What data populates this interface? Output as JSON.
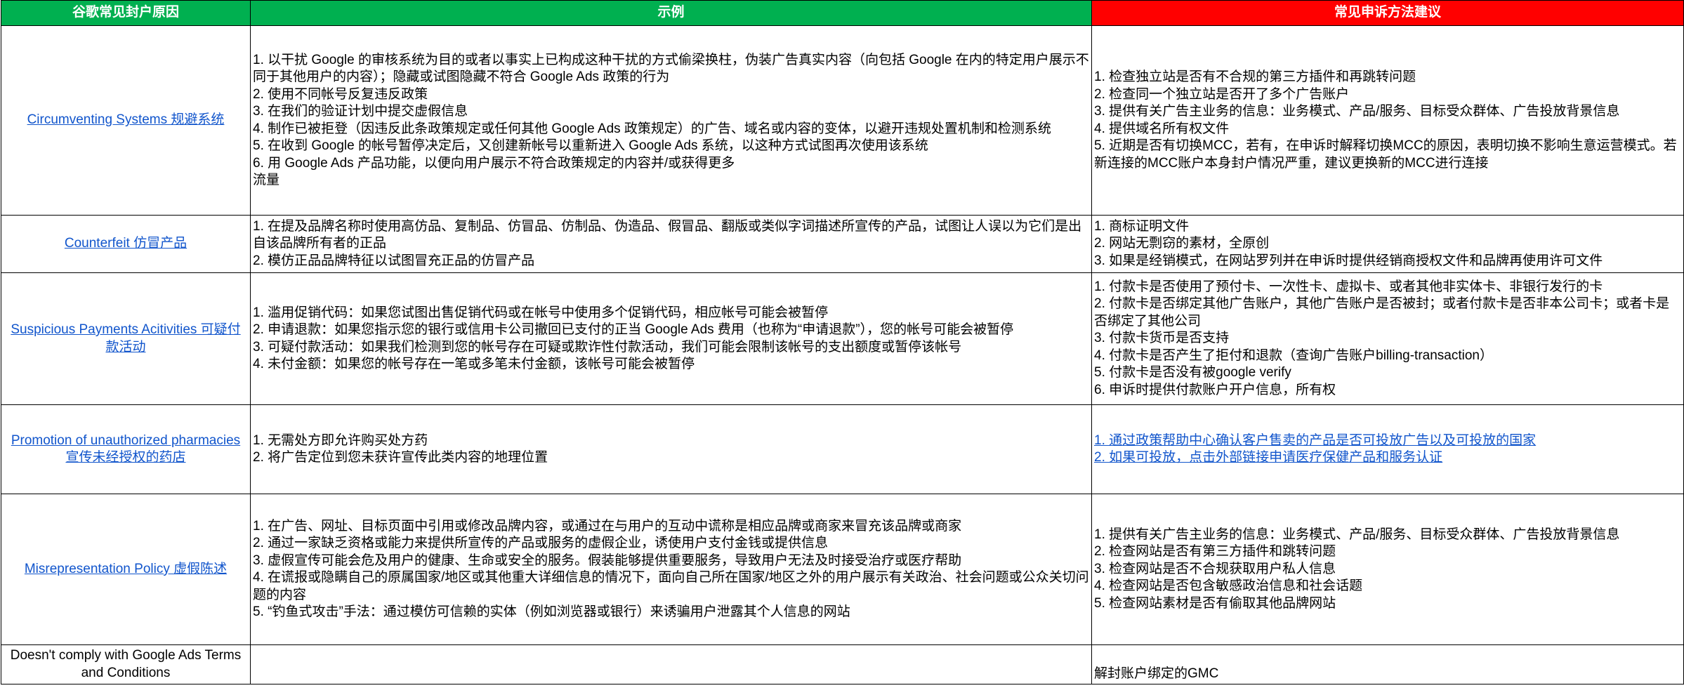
{
  "headers": {
    "reason": "谷歌常见封户原因",
    "example": "示例",
    "appeal": "常见申诉方法建议"
  },
  "colors": {
    "header_green": "#00b050",
    "header_red": "#ff0000",
    "link_blue": "#1155cc"
  },
  "rows": [
    {
      "reason": "Circumventing Systems 规避系统",
      "reason_is_link": true,
      "examples": [
        "1. 以干扰 Google 的审核系统为目的或者以事实上已构成这种干扰的方式偷梁换柱，伪装广告真实内容（向包括 Google 在内的特定用户展示不同于其他用户的内容）；隐藏或试图隐藏不符合 Google Ads 政策的行为",
        "2. 使用不同帐号反复违反政策",
        "3. 在我们的验证计划中提交虚假信息",
        "4. 制作已被拒登（因违反此条政策规定或任何其他 Google Ads 政策规定）的广告、域名或内容的变体，以避开违规处置机制和检测系统",
        "5. 在收到 Google 的帐号暂停决定后，又创建新帐号以重新进入 Google Ads 系统，以这种方式试图再次使用该系统",
        "6. 用 Google Ads 产品功能，以便向用户展示不符合政策规定的内容并/或获得更多",
        "流量"
      ],
      "appeals": [
        "1. 检查独立站是否有不合规的第三方插件和再跳转问题",
        "2. 检查同一个独立站是否开了多个广告账户",
        "3. 提供有关广告主业务的信息：业务模式、产品/服务、目标受众群体、广告投放背景信息",
        "4. 提供域名所有权文件",
        "5. 近期是否有切换MCC，若有，在申诉时解释切换MCC的原因，表明切换不影响生意运营模式。若新连接的MCC账户本身封户情况严重，建议更换新的MCC进行连接"
      ],
      "appeals_are_links": false
    },
    {
      "reason": "Counterfeit 仿冒产品",
      "reason_is_link": true,
      "examples": [
        "1. 在提及品牌名称时使用高仿品、复制品、仿冒品、仿制品、伪造品、假冒品、翻版或类似字词描述所宣传的产品，试图让人误以为它们是出自该品牌所有者的正品",
        "2. 模仿正品品牌特征以试图冒充正品的仿冒产品"
      ],
      "appeals": [
        "1. 商标证明文件",
        "2. 网站无剽窃的素材，全原创",
        "3. 如果是经销模式，在网站罗列并在申诉时提供经销商授权文件和品牌再使用许可文件"
      ],
      "appeals_are_links": false
    },
    {
      "reason": "Suspicious Payments Acitivities 可疑付款活动",
      "reason_is_link": true,
      "examples": [
        "1. 滥用促销代码：如果您试图出售促销代码或在帐号中使用多个促销代码，相应帐号可能会被暂停",
        "2. 申请退款：如果您指示您的银行或信用卡公司撤回已支付的正当 Google Ads 费用（也称为“申请退款”），您的帐号可能会被暂停",
        "3. 可疑付款活动：如果我们检测到您的帐号存在可疑或欺诈性付款活动，我们可能会限制该帐号的支出额度或暂停该帐号",
        "4. 未付金额：如果您的帐号存在一笔或多笔未付金额，该帐号可能会被暂停"
      ],
      "appeals": [
        "1. 付款卡是否使用了预付卡、一次性卡、虚拟卡、或者其他非实体卡、非银行发行的卡",
        "2. 付款卡是否绑定其他广告账户，其他广告账户是否被封；或者付款卡是否非本公司卡；或者卡是否绑定了其他公司",
        "3. 付款卡货币是否支持",
        "4. 付款卡是否产生了拒付和退款（查询广告账户billing-transaction）",
        "5. 付款卡是否没有被google verify",
        "6. 申诉时提供付款账户开户信息，所有权"
      ],
      "appeals_are_links": false
    },
    {
      "reason": "Promotion of unauthorized pharmacies 宣传未经授权的药店",
      "reason_is_link": true,
      "examples": [
        "1. 无需处方即允许购买处方药",
        "2. 将广告定位到您未获许宣传此类内容的地理位置"
      ],
      "appeals": [
        "1. 通过政策帮助中心确认客户售卖的产品是否可投放广告以及可投放的国家",
        "2. 如果可投放，点击外部链接申请医疗保健产品和服务认证"
      ],
      "appeals_are_links": true
    },
    {
      "reason": "Misrepresentation Policy 虚假陈述",
      "reason_is_link": true,
      "examples": [
        "1. 在广告、网址、目标页面中引用或修改品牌内容，或通过在与用户的互动中谎称是相应品牌或商家来冒充该品牌或商家",
        "2. 通过一家缺乏资格或能力来提供所宣传的产品或服务的虚假企业，诱使用户支付金钱或提供信息",
        "3. 虚假宣传可能会危及用户的健康、生命或安全的服务。假装能够提供重要服务，导致用户无法及时接受治疗或医疗帮助",
        "4. 在谎报或隐瞒自己的原属国家/地区或其他重大详细信息的情况下，面向自己所在国家/地区之外的用户展示有关政治、社会问题或公众关切问题的内容",
        "5. “钓鱼式攻击”手法：通过模仿可信赖的实体（例如浏览器或银行）来诱骗用户泄露其个人信息的网站"
      ],
      "appeals": [
        "1. 提供有关广告主业务的信息：业务模式、产品/服务、目标受众群体、广告投放背景信息",
        "2. 检查网站是否有第三方插件和跳转问题",
        "3. 检查网站是否不合规获取用户私人信息",
        "4. 检查网站是否包含敏感政治信息和社会话题",
        "5. 检查网站素材是否有偷取其他品牌网站"
      ],
      "appeals_are_links": false
    },
    {
      "reason": "Doesn't comply with Google Ads Terms and Conditions",
      "reason_is_link": false,
      "examples": [],
      "appeals": [
        "解封账户绑定的GMC"
      ],
      "appeals_are_links": false
    }
  ]
}
